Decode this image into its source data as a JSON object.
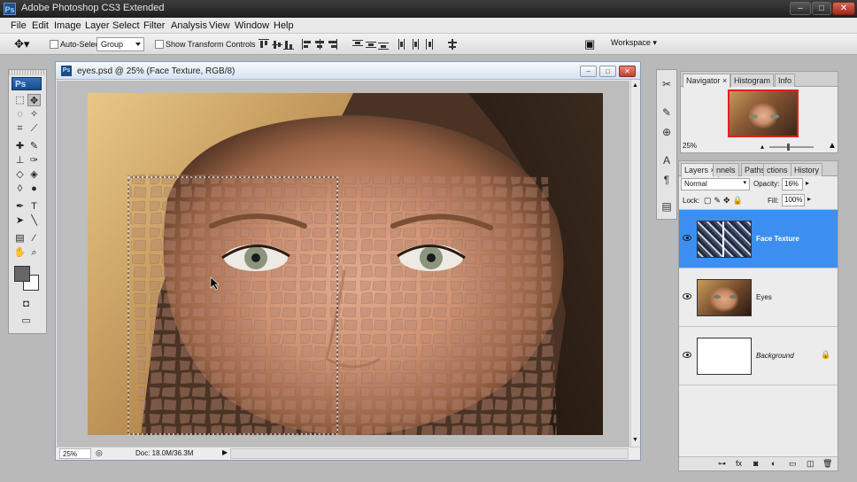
{
  "app": {
    "title": "Adobe Photoshop CS3 Extended",
    "logo": "Ps"
  },
  "menu": [
    "File",
    "Edit",
    "Image",
    "Layer",
    "Select",
    "Filter",
    "Analysis",
    "View",
    "Window",
    "Help"
  ],
  "options_bar": {
    "auto_select_label": "Auto-Select:",
    "auto_select_value": "Group",
    "show_transform_label": "Show Transform Controls",
    "workspace_label": "Workspace"
  },
  "document": {
    "title": "eyes.psd @ 25% (Face Texture, RGB/8)",
    "zoom": "25%",
    "doc_size": "Doc: 18.0M/36.3M"
  },
  "navigator": {
    "tabs": [
      "Navigator",
      "Histogram",
      "Info"
    ],
    "zoom": "25%"
  },
  "layers": {
    "tabs": [
      "Layers",
      "nnels",
      "Paths",
      "ctions",
      "History"
    ],
    "blend_mode": "Normal",
    "opacity_label": "Opacity:",
    "opacity_value": "16%",
    "lock_label": "Lock:",
    "fill_label": "Fill:",
    "fill_value": "100%",
    "items": [
      {
        "name": "Face Texture",
        "selected": true
      },
      {
        "name": "Eyes",
        "selected": false
      },
      {
        "name": "Background",
        "selected": false
      }
    ]
  },
  "colors": {
    "selection": "#3c8ff0",
    "navigator_frame": "#e02020"
  }
}
